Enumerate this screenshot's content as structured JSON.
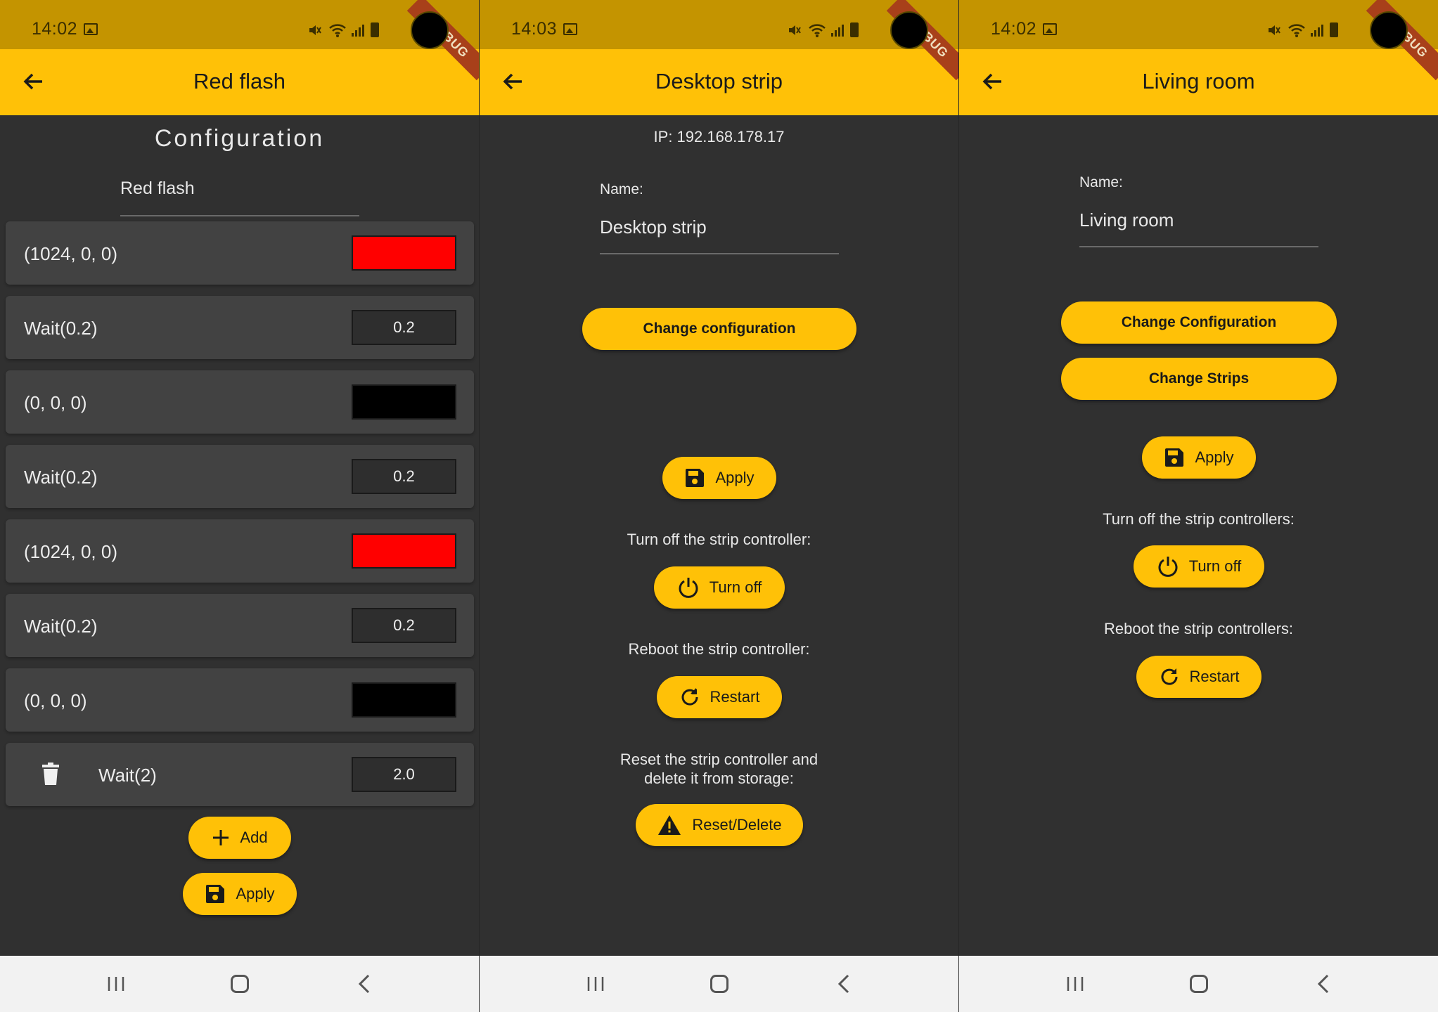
{
  "status": {
    "time_1": "14:02",
    "time_2": "14:03",
    "time_3": "14:02",
    "debug_banner": "DEBUG"
  },
  "colors": {
    "accent": "#ffc107",
    "statusbar": "#c49400",
    "background": "#303030",
    "card": "#424242",
    "red": "#ff0000",
    "black": "#000000"
  },
  "screen1": {
    "title": "Red flash",
    "heading": "Configuration",
    "name_value": "Red flash",
    "steps": [
      {
        "label": "(1024, 0, 0)",
        "type": "color",
        "color": "#ff0000"
      },
      {
        "label": "Wait(0.2)",
        "type": "wait",
        "value": "0.2"
      },
      {
        "label": "(0, 0, 0)",
        "type": "color",
        "color": "#000000"
      },
      {
        "label": "Wait(0.2)",
        "type": "wait",
        "value": "0.2"
      },
      {
        "label": "(1024, 0, 0)",
        "type": "color",
        "color": "#ff0000"
      },
      {
        "label": "Wait(0.2)",
        "type": "wait",
        "value": "0.2"
      },
      {
        "label": "(0, 0, 0)",
        "type": "color",
        "color": "#000000"
      },
      {
        "label": "Wait(2)",
        "type": "wait",
        "value": "2.0"
      }
    ],
    "add_label": "Add",
    "apply_label": "Apply"
  },
  "screen2": {
    "title": "Desktop strip",
    "ip_text": "IP: 192.168.178.17",
    "name_label": "Name:",
    "name_value": "Desktop strip",
    "change_config_label": "Change configuration",
    "apply_label": "Apply",
    "turn_off_caption": "Turn off the strip controller:",
    "turn_off_label": "Turn off",
    "reboot_caption": "Reboot the strip controller:",
    "restart_label": "Restart",
    "reset_caption_line1": "Reset the strip controller and",
    "reset_caption_line2": "delete it from storage:",
    "reset_label": "Reset/Delete"
  },
  "screen3": {
    "title": "Living room",
    "name_label": "Name:",
    "name_value": "Living room",
    "change_config_label": "Change Configuration",
    "change_strips_label": "Change Strips",
    "apply_label": "Apply",
    "turn_off_caption": "Turn off the strip controllers:",
    "turn_off_label": "Turn off",
    "reboot_caption": "Reboot the strip controllers:",
    "restart_label": "Restart"
  }
}
